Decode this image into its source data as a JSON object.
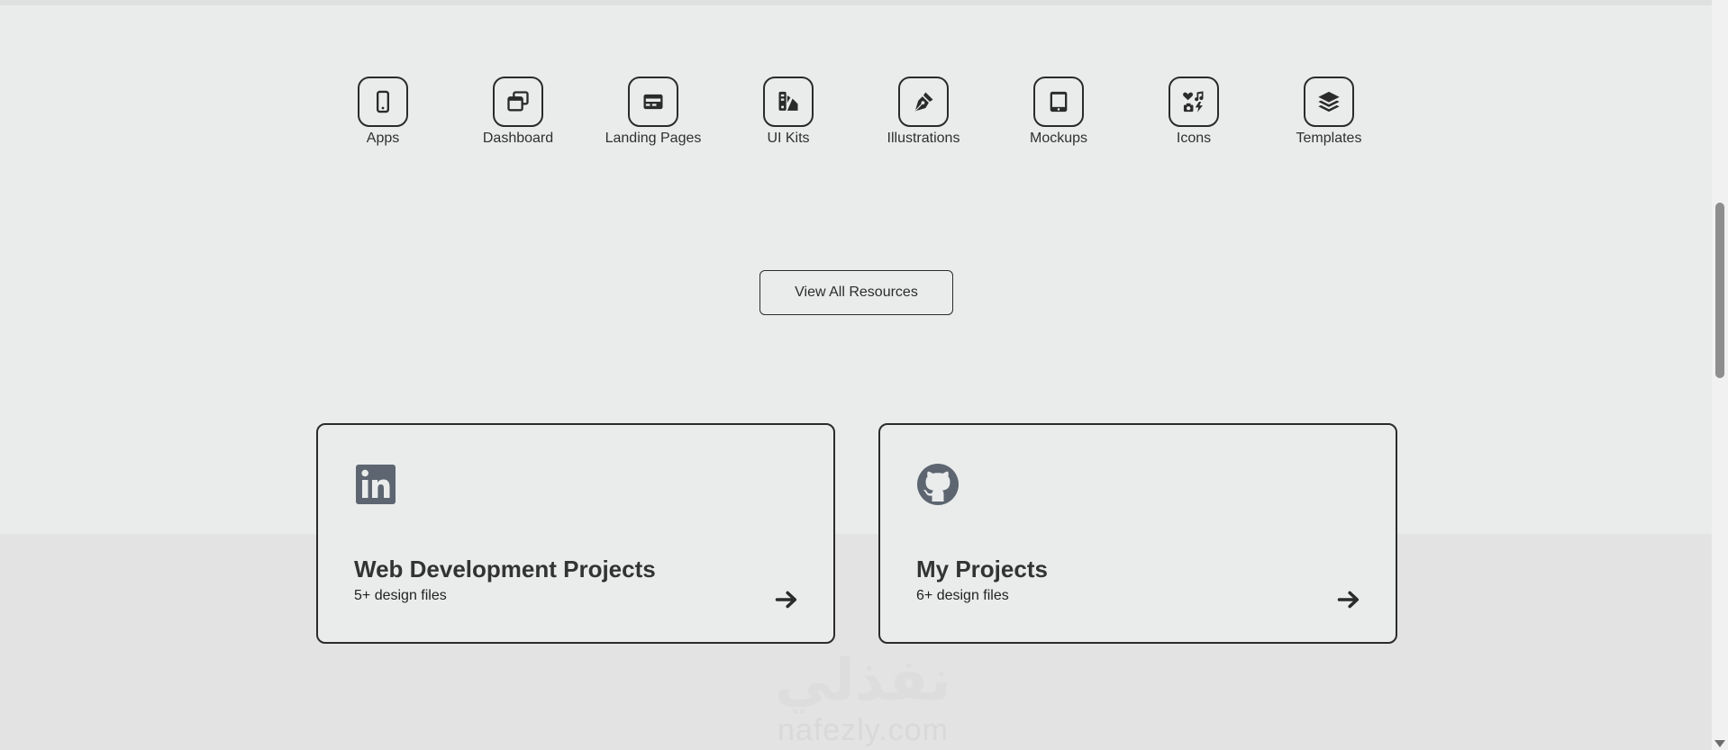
{
  "categories": [
    {
      "label": "Apps",
      "icon": "mobile-phone-icon"
    },
    {
      "label": "Dashboard",
      "icon": "windows-stack-icon"
    },
    {
      "label": "Landing Pages",
      "icon": "credit-card-icon"
    },
    {
      "label": "UI Kits",
      "icon": "swatchbook-icon"
    },
    {
      "label": "Illustrations",
      "icon": "pen-nib-icon"
    },
    {
      "label": "Mockups",
      "icon": "tablet-icon"
    },
    {
      "label": "Icons",
      "icon": "icons-collection-icon"
    },
    {
      "label": "Templates",
      "icon": "layers-icon"
    }
  ],
  "view_all_label": "View All Resources",
  "cards": [
    {
      "title": "Web Development Projects",
      "subtitle": "5+ design files",
      "icon": "linkedin-icon"
    },
    {
      "title": "My Projects",
      "subtitle": "6+ design files",
      "icon": "github-icon"
    }
  ],
  "watermark": {
    "arabic": "نفذلي",
    "latin": "nafezly.com"
  },
  "colors": {
    "background": "#eaecec",
    "lower_band": "#e2e3e2",
    "border": "#2b2b2b",
    "icon_gray": "#5c6570"
  }
}
